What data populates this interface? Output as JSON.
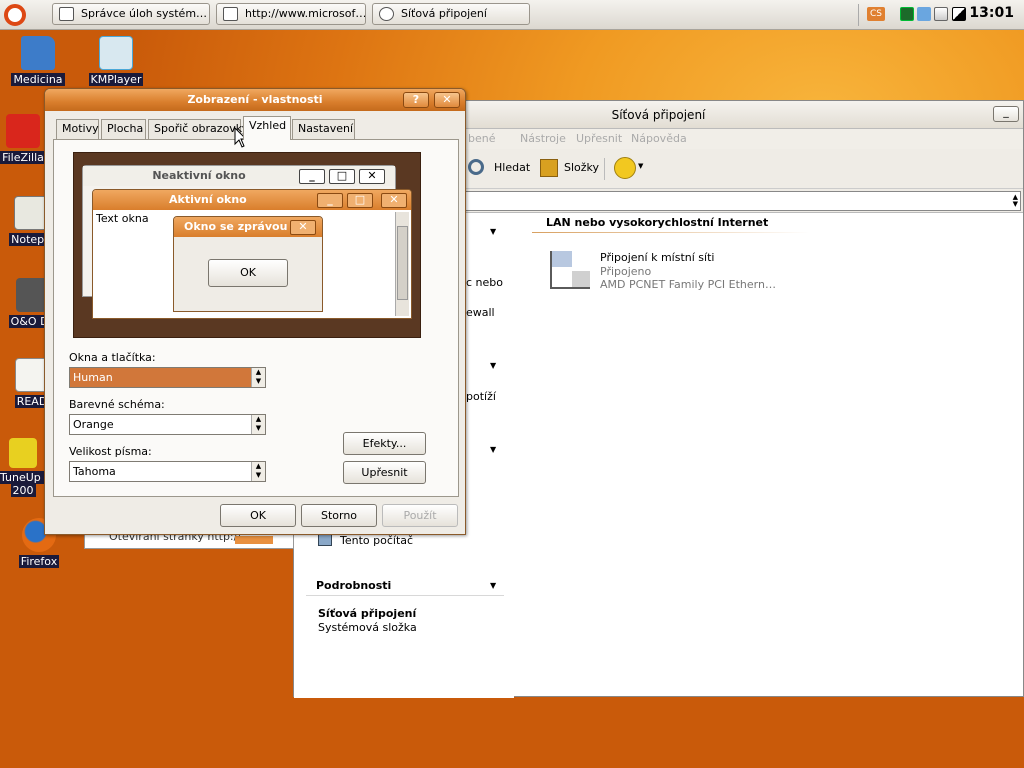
{
  "taskbar": {
    "buttons": [
      "Správce úloh systém…",
      "http://www.microsof…",
      "Síťová připojení"
    ],
    "tray_cs": "CS",
    "clock": "13:01"
  },
  "desktop_icons": [
    {
      "label": "Medicina",
      "color": "#3d7cc9"
    },
    {
      "label": "KMPlayer",
      "color": "#4aa8d8"
    },
    {
      "label": "FileZilla",
      "color": "#d9261c"
    },
    {
      "label": "Notepa",
      "color": "#d8d8d0"
    },
    {
      "label": "O&O De",
      "color": "#444444"
    },
    {
      "label": "READ",
      "color": "#e8e8e8"
    },
    {
      "label": "TuneUp U",
      "label2": "200",
      "color": "#e8d020"
    },
    {
      "label": "Firefox",
      "color": "#e46a12"
    }
  ],
  "explorer": {
    "title": "Síťová připojení",
    "menu": [
      "bené",
      "Nástroje",
      "Upřesnit",
      "Nápověda"
    ],
    "toolbar": {
      "search": "Hledat",
      "folders": "Složky"
    },
    "side": {
      "frag1": "c nebo",
      "frag2": "ewall",
      "frag3": "potíží",
      "this_computer": "Tento počítač",
      "details_header": "Podrobnosti",
      "details_title": "Síťová připojení",
      "details_sub": "Systémová složka"
    },
    "group_header": "LAN nebo vysokorychlostní Internet",
    "connection": {
      "name": "Připojení k místní síti",
      "status": "Připojeno",
      "device": "AMD PCNET Family PCI Ethern…"
    }
  },
  "dialog": {
    "title": "Zobrazení - vlastnosti",
    "help": "?",
    "close": "✕",
    "tabs": [
      "Motivy",
      "Plocha",
      "Spořič obrazovky",
      "Vzhled",
      "Nastavení"
    ],
    "active_tab": "Vzhled",
    "preview": {
      "inactive": "Neaktivní okno",
      "active": "Aktivní okno",
      "window_text": "Text okna",
      "message": "Okno se zprávou",
      "ok": "OK"
    },
    "windows_buttons_label": "Okna a tlačítka:",
    "windows_buttons_value": "Human",
    "color_scheme_label": "Barevné schéma:",
    "color_scheme_value": "Orange",
    "font_size_label": "Velikost písma:",
    "font_size_value": "Tahoma",
    "effects": "Efekty...",
    "advanced": "Upřesnit",
    "ok": "OK",
    "cancel": "Storno",
    "apply": "Použít"
  },
  "behind_text": "Otevírání stránky http://",
  "colors": {
    "accent": "#d97e2c",
    "desktop": "#f09a22",
    "selection": "#d1773a"
  }
}
